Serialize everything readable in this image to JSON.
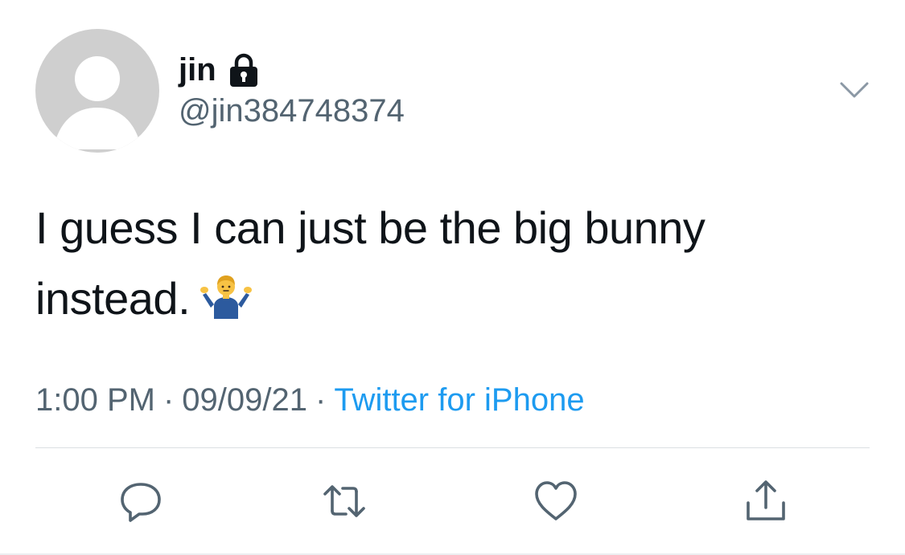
{
  "tweet": {
    "display_name": "jin",
    "username": "@jin384748374",
    "text_line1": "I guess I can just be the big bunny",
    "text_line2": "instead.",
    "emoji": "shrug-emoji",
    "time": "1:00 PM",
    "date": "09/09/21",
    "separator": "·",
    "source": "Twitter for iPhone"
  },
  "icons": {
    "lock": "lock-icon",
    "caret": "chevron-down-icon",
    "reply": "reply-icon",
    "retweet": "retweet-icon",
    "like": "heart-icon",
    "share": "share-icon"
  },
  "colors": {
    "text": "#0f1419",
    "secondary": "#536471",
    "link": "#1d9bf0",
    "avatar": "#cfcfcf"
  }
}
